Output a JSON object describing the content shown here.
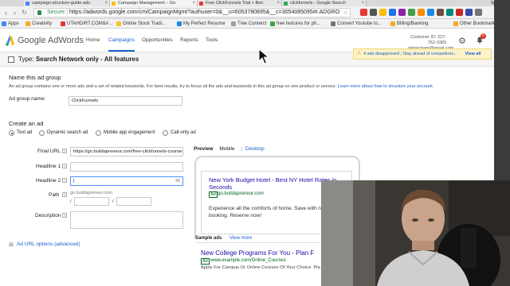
{
  "browser": {
    "tabs": [
      {
        "title": "campaign-structure-guide-ads"
      },
      {
        "title": "Campaign Management – Go"
      },
      {
        "title": "Free ClickFunnels Trial + Bon"
      },
      {
        "title": "clickfunnels - Google Search"
      }
    ],
    "profile": "Spencer",
    "url_secure_label": "Secure",
    "url": "https://adwords.google.com/cm/CampaignMgmt?authuser=0&__u=6053780895&__c=3054085095#r.ADGRO",
    "bookmarks": [
      {
        "label": "Apps"
      },
      {
        "label": "Creativity"
      },
      {
        "label": "UTAHDIRT.COM&#..."
      },
      {
        "label": "Online Stock Tradi..."
      },
      {
        "label": "My Perfect Resume"
      },
      {
        "label": "Tree Connect"
      },
      {
        "label": "free textures for ph..."
      },
      {
        "label": "Convert Youtube to..."
      },
      {
        "label": "Billing/Banking"
      },
      {
        "label": "Other Bookmarks"
      }
    ]
  },
  "adwords": {
    "brand": "Google AdWords",
    "nav": [
      {
        "label": "Home"
      },
      {
        "label": "Campaigns"
      },
      {
        "label": "Opportunities"
      },
      {
        "label": "Reports"
      },
      {
        "label": "Tools"
      }
    ],
    "customer_id": "Customer ID: 227-762-3383",
    "customer_email": "skmecham@gmail.com",
    "notifications_count": "6",
    "alert": {
      "text": "4 ads disapproved",
      "link": "Stay ahead of competitors...",
      "view_all": "View all"
    }
  },
  "type_bar": {
    "prefix": "Type:",
    "value": "Search Network only - All features"
  },
  "ad_group": {
    "section_title": "Name this ad group",
    "description": "An ad group contains one or more ads and a set of related keywords. For best results, try to focus all the ads and keywords in this ad group on one product or service.",
    "description_link": "Learn more about how to structure your account.",
    "name_label": "Ad group name:",
    "name_value": "ClickFunnels"
  },
  "create_ad": {
    "section_title": "Create an ad",
    "types": [
      {
        "label": "Text ad",
        "selected": true
      },
      {
        "label": "Dynamic search ad",
        "selected": false
      },
      {
        "label": "Mobile app engagement",
        "selected": false
      },
      {
        "label": "Call-only ad",
        "selected": false
      }
    ],
    "final_url_label": "Final URL",
    "final_url_value": "https://go.buildapreneur.com/free-clickfunnels-course-c",
    "headline1_label": "Headline 1",
    "headline1_value": "",
    "headline2_label": "Headline 2",
    "headline2_value": "|",
    "headline2_counter": "30",
    "path_label": "Path",
    "path_domain": "go.buildapreneur.com",
    "path_sep": "/",
    "description_label": "Description",
    "url_options_link": "Ad URL options (advanced)"
  },
  "preview": {
    "tabs": [
      {
        "label": "Preview"
      },
      {
        "label": "Mobile"
      },
      {
        "label": "Desktop"
      }
    ],
    "ad_headline_line1": "New York Budget Hotel - Best NY Hotel Rates in",
    "ad_headline_line2": "Seconds",
    "ad_badge": "Ad",
    "ad_url": "go.buildapreneur.com",
    "ad_body_line1": "Experience all the comforts of home. Save with n",
    "ad_body_line2": "booking. Reserve now!",
    "sample_ads_label": "Sample ads",
    "view_more": "View more",
    "sample_headline": "New College Programs For You - Plan F",
    "sample_badge": "Ad",
    "sample_url": "www.example.com/Online_Courses",
    "sample_body": "Apply For Campus Or Online Courses Of Your Choice. Pla"
  },
  "colors": {
    "link_blue": "#1a5fc8",
    "ad_headline": "#1a0dab",
    "ad_green": "#006621",
    "alert_bg": "#fdf3c9"
  }
}
